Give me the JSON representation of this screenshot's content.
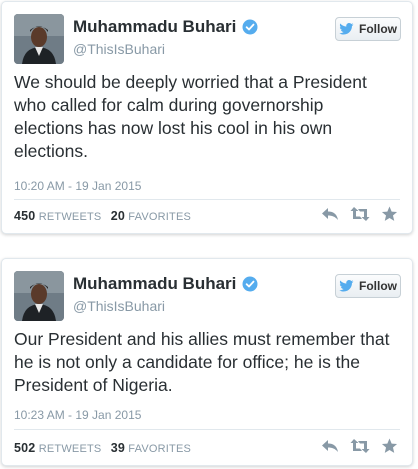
{
  "tweets": [
    {
      "author_name": "Muhammadu Buhari",
      "handle": "@ThisIsBuhari",
      "follow_label": "Follow",
      "text": "We should be deeply worried that a President who called for calm during governorship elections has now lost his cool in his own elections.",
      "timestamp": "10:20 AM - 19 Jan 2015",
      "retweets": "450",
      "retweets_label": "RETWEETS",
      "favorites": "20",
      "favorites_label": "FAVORITES"
    },
    {
      "author_name": "Muhammadu Buhari",
      "handle": "@ThisIsBuhari",
      "follow_label": "Follow",
      "text": "Our President and his allies must remember that he is not only a candidate for office; he is the President of Nigeria.",
      "timestamp": "10:23 AM - 19 Jan 2015",
      "retweets": "502",
      "retweets_label": "RETWEETS",
      "favorites": "39",
      "favorites_label": "FAVORITES"
    }
  ],
  "icons": {
    "verified": "verified-badge-icon",
    "bird": "twitter-bird-icon",
    "reply": "reply-icon",
    "retweet": "retweet-icon",
    "favorite": "star-icon"
  },
  "colors": {
    "verified_blue": "#55acee",
    "bird_blue": "#55acee",
    "text": "#292f33",
    "muted": "#8899a6",
    "action_gray": "#8899a6"
  }
}
